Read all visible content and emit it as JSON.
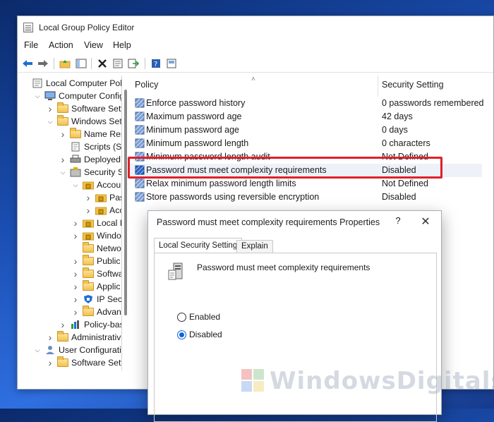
{
  "window": {
    "title": "Local Group Policy Editor"
  },
  "menu": [
    "File",
    "Action",
    "View",
    "Help"
  ],
  "tree": [
    {
      "label": "Local Computer Polic",
      "depth": 0,
      "chevron": "",
      "icon": "computer-policy-icon"
    },
    {
      "label": "Computer Config",
      "depth": 1,
      "chevron": "v",
      "icon": "computer-icon"
    },
    {
      "label": "Software Setti",
      "depth": 2,
      "chevron": ">",
      "icon": "folder-icon"
    },
    {
      "label": "Windows Sett",
      "depth": 2,
      "chevron": "v",
      "icon": "folder-icon"
    },
    {
      "label": "Name Res",
      "depth": 3,
      "chevron": ">",
      "icon": "folder-icon"
    },
    {
      "label": "Scripts (Sta",
      "depth": 3,
      "chevron": "",
      "icon": "script-icon"
    },
    {
      "label": "Deployed",
      "depth": 3,
      "chevron": ">",
      "icon": "printer-icon"
    },
    {
      "label": "Security Se",
      "depth": 3,
      "chevron": "v",
      "icon": "security-settings-icon"
    },
    {
      "label": "Accou",
      "depth": 4,
      "chevron": "v",
      "icon": "lock-folder-icon"
    },
    {
      "label": "Pas",
      "depth": 5,
      "chevron": ">",
      "icon": "lock-folder-icon"
    },
    {
      "label": "Acc",
      "depth": 5,
      "chevron": ">",
      "icon": "lock-folder-icon"
    },
    {
      "label": "Local P",
      "depth": 4,
      "chevron": ">",
      "icon": "lock-folder-icon"
    },
    {
      "label": "Windo",
      "depth": 4,
      "chevron": ">",
      "icon": "lock-folder-icon"
    },
    {
      "label": "Netwo",
      "depth": 4,
      "chevron": "",
      "icon": "folder-icon"
    },
    {
      "label": "Public",
      "depth": 4,
      "chevron": ">",
      "icon": "folder-icon"
    },
    {
      "label": "Softwa",
      "depth": 4,
      "chevron": ">",
      "icon": "folder-icon"
    },
    {
      "label": "Applic",
      "depth": 4,
      "chevron": ">",
      "icon": "folder-icon"
    },
    {
      "label": "IP Secu",
      "depth": 4,
      "chevron": ">",
      "icon": "shield-network-icon"
    },
    {
      "label": "Advan",
      "depth": 4,
      "chevron": ">",
      "icon": "folder-icon"
    },
    {
      "label": "Policy-bas",
      "depth": 3,
      "chevron": ">",
      "icon": "chart-icon"
    },
    {
      "label": "Administrative",
      "depth": 2,
      "chevron": ">",
      "icon": "folder-icon"
    },
    {
      "label": "User Configuration",
      "depth": 1,
      "chevron": "v",
      "icon": "user-icon"
    },
    {
      "label": "Software Settin",
      "depth": 2,
      "chevron": ">",
      "icon": "folder-icon"
    }
  ],
  "list": {
    "col_policy": "Policy",
    "col_setting": "Security Setting",
    "rows": [
      {
        "policy": "Enforce password history",
        "setting": "0 passwords remembered"
      },
      {
        "policy": "Maximum password age",
        "setting": "42 days"
      },
      {
        "policy": "Minimum password age",
        "setting": "0 days"
      },
      {
        "policy": "Minimum password length",
        "setting": "0 characters"
      },
      {
        "policy": "Minimum password length audit",
        "setting": "Not Defined"
      },
      {
        "policy": "Password must meet complexity requirements",
        "setting": "Disabled"
      },
      {
        "policy": "Relax minimum password length limits",
        "setting": "Not Defined"
      },
      {
        "policy": "Store passwords using reversible encryption",
        "setting": "Disabled"
      }
    ]
  },
  "dialog": {
    "title": "Password must meet complexity requirements Properties",
    "help": "?",
    "close": "✕",
    "tabs": [
      "Local Security Setting",
      "Explain"
    ],
    "policy_name": "Password must meet complexity requirements",
    "options": [
      "Enabled",
      "Disabled"
    ],
    "selected": "Disabled"
  },
  "watermark": {
    "text": "WindowsDigitals.com"
  },
  "colors": {
    "highlight": "#e0202a",
    "accent": "#0a64d8"
  }
}
